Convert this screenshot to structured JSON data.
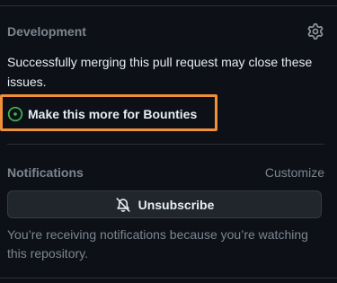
{
  "development": {
    "title": "Development",
    "gear_icon": "gear-icon",
    "description": "Successfully merging this pull request may close these issues.",
    "issue": {
      "label": "Make this more for Bounties",
      "icon": "issue-open-icon",
      "status_color": "#3fb950"
    },
    "highlight_color": "#f0913a"
  },
  "notifications": {
    "title": "Notifications",
    "customize_label": "Customize",
    "unsubscribe_label": "Unsubscribe",
    "unsubscribe_icon": "bell-slash-icon",
    "description": "You’re receiving notifications because you’re watching this repository."
  }
}
